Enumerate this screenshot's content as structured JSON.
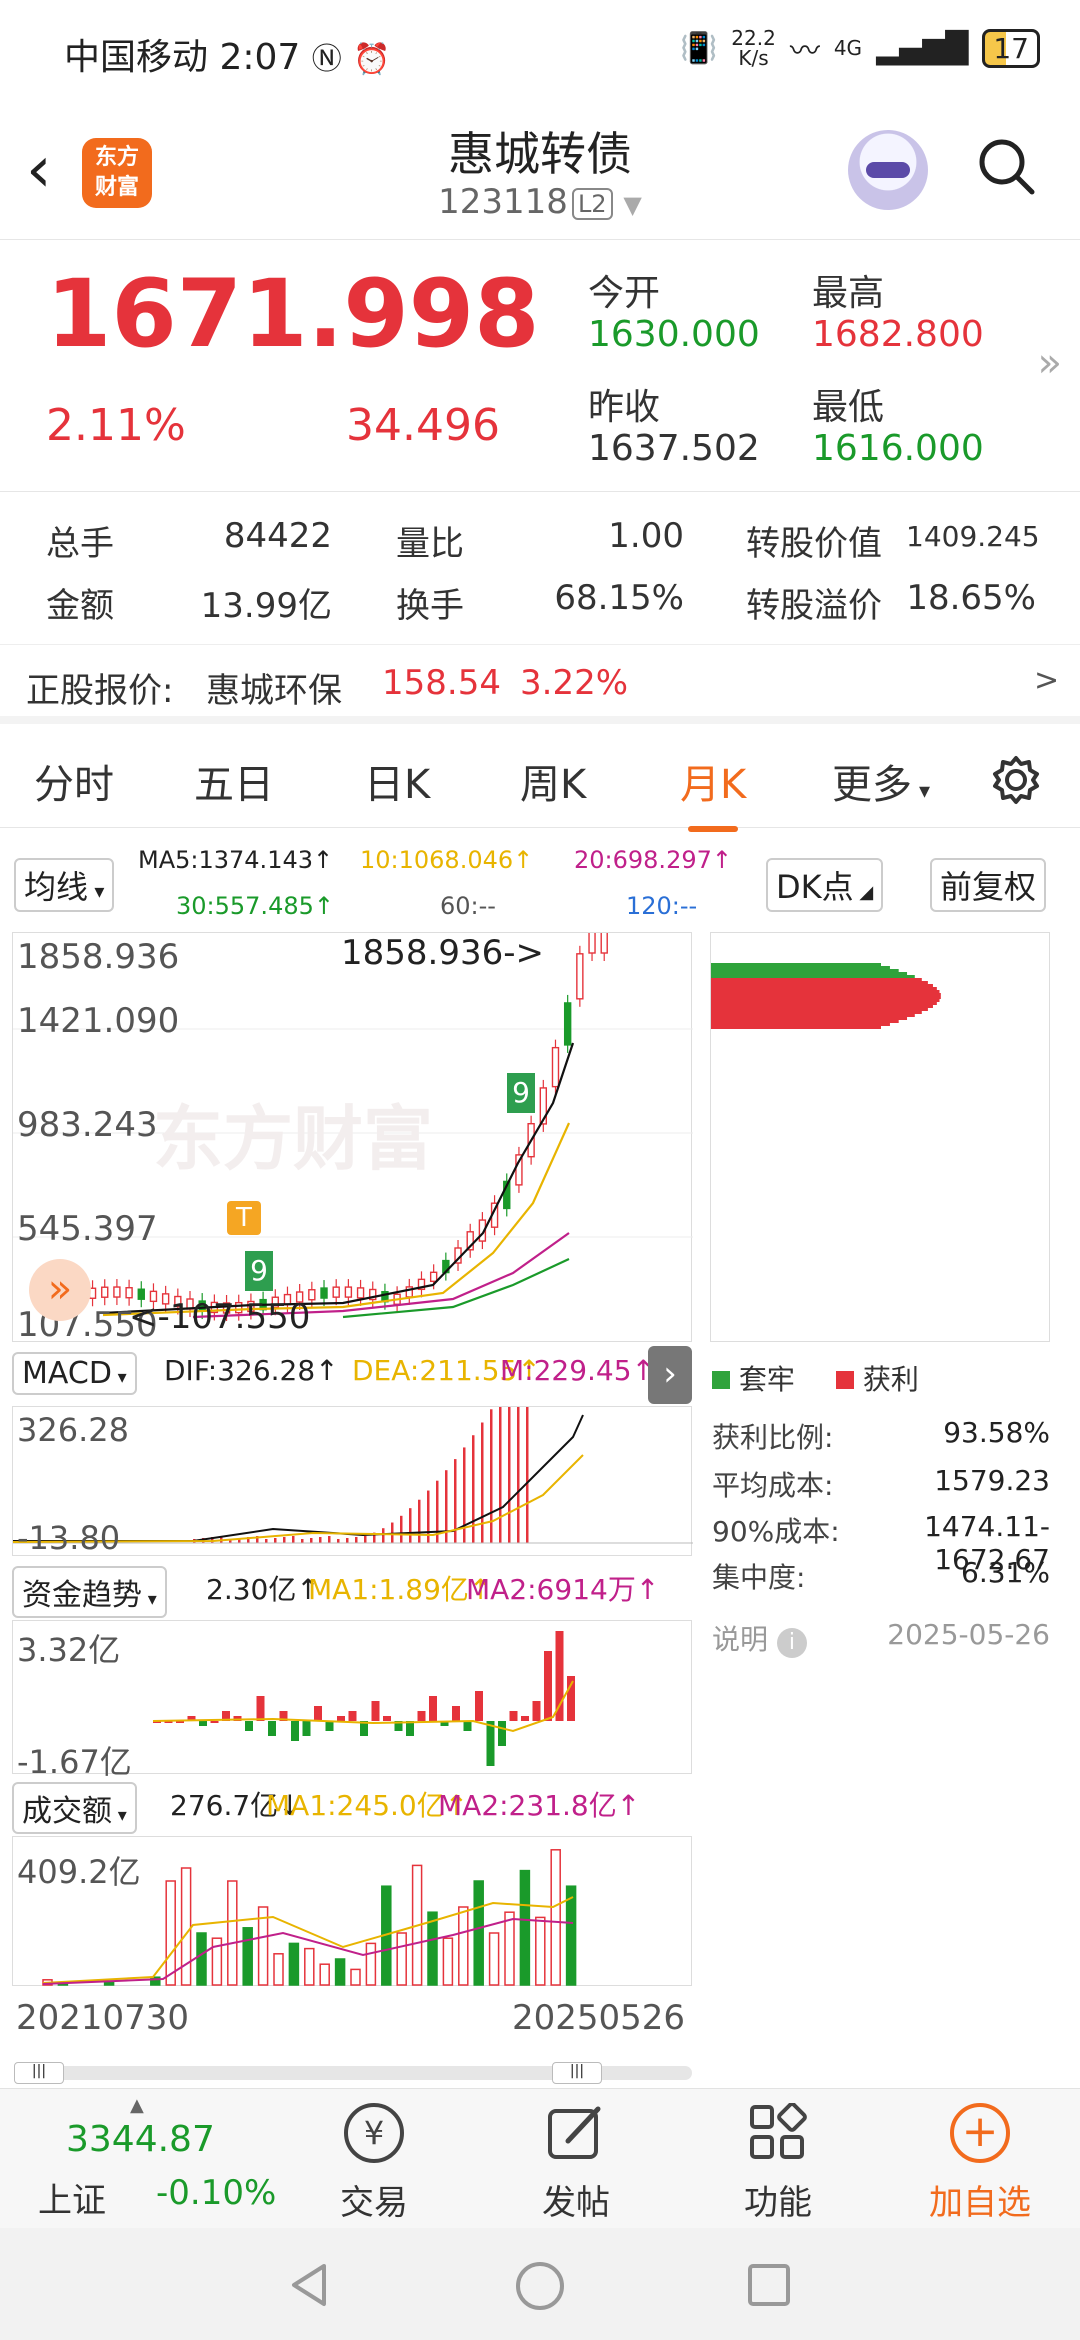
{
  "status": {
    "carrier": "中国移动",
    "time": "2:07",
    "net_speed": "22.2\nK/s",
    "network": "4G",
    "battery": "17"
  },
  "header": {
    "logo_text": "东方\n财富",
    "title": "惠城转债",
    "code": "123118",
    "level": "L2"
  },
  "quote": {
    "price": "1671.998",
    "change_pct": "2.11%",
    "change": "34.496",
    "open_label": "今开",
    "open": "1630.000",
    "high_label": "最高",
    "high": "1682.800",
    "prev_close_label": "昨收",
    "prev_close": "1637.502",
    "low_label": "最低",
    "low": "1616.000"
  },
  "stats": {
    "volume_label": "总手",
    "volume": "84422",
    "vol_ratio_label": "量比",
    "vol_ratio": "1.00",
    "conv_value_label": "转股价值",
    "conv_value": "1409.245",
    "amount_label": "金额",
    "amount": "13.99亿",
    "turnover_label": "换手",
    "turnover": "68.15%",
    "premium_label": "转股溢价",
    "premium": "18.65%"
  },
  "underlying": {
    "label": "正股报价:",
    "name": "惠城环保",
    "price": "158.54",
    "pct": "3.22%",
    "arrow": ">"
  },
  "tabs": [
    "分时",
    "五日",
    "日K",
    "周K",
    "月K",
    "更多"
  ],
  "active_tab": "月K",
  "ma": {
    "selector": "均线",
    "ma5": "MA5:1374.143↑",
    "ma10": "10:1068.046↑",
    "ma20": "20:698.297↑",
    "ma30": "30:557.485↑",
    "ma60": "60:--",
    "ma120": "120:--",
    "dk": "DK点",
    "adjust": "前复权"
  },
  "kline": {
    "y_labels": [
      "1858.936",
      "1421.090",
      "983.243",
      "545.397",
      "107.550"
    ],
    "max_note": "1858.936->",
    "min_note": "<-107.550",
    "watermark": "东方财富",
    "signals": [
      "T",
      "9",
      "9"
    ]
  },
  "macd": {
    "selector": "MACD",
    "dif": "DIF:326.28↑",
    "dea": "DEA:211.55↑",
    "m": "M:229.45↑",
    "top": "326.28",
    "bottom": "-13.80"
  },
  "fund": {
    "selector": "资金趋势",
    "value": "2.30亿↑",
    "ma1": "MA1:1.89亿↑",
    "ma2": "MA2:6914万↑",
    "top": "3.32亿",
    "bottom": "-1.67亿"
  },
  "amount": {
    "selector": "成交额",
    "value": "276.7亿↓",
    "ma1": "MA1:245.0亿↑",
    "ma2": "MA2:231.8亿↑",
    "top": "409.2亿",
    "start_date": "20210730",
    "end_date": "20250526"
  },
  "chips": {
    "legend_trapped": "套牢",
    "legend_profit": "获利",
    "profit_ratio_label": "获利比例:",
    "profit_ratio": "93.58%",
    "avg_cost_label": "平均成本:",
    "avg_cost": "1579.23",
    "cost90_label": "90%成本:",
    "cost90": "1474.11-1672.67",
    "concentration_label": "集中度:",
    "concentration": "6.31%",
    "note_label": "说明",
    "date": "2025-05-26"
  },
  "bottom": {
    "index_value": "3344.87",
    "index_name": "上证",
    "index_pct": "-0.10%",
    "trade": "交易",
    "post": "发帖",
    "function": "功能",
    "add": "加自选"
  },
  "colors": {
    "up": "#e5333b",
    "down": "#1a9a2a",
    "accent": "#f26b1d",
    "ma10": "#e8b400",
    "ma20": "#c0208a"
  }
}
